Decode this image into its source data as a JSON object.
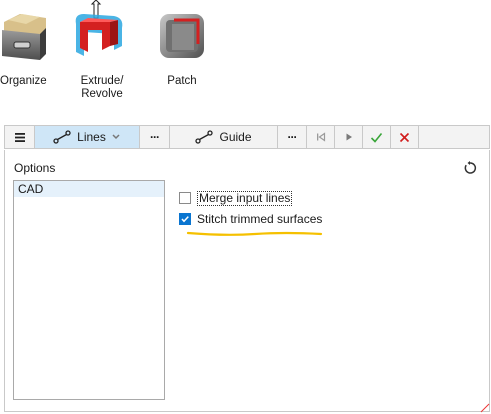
{
  "ribbon": {
    "tools": [
      {
        "label": "Organize",
        "icon": "organize-box-icon"
      },
      {
        "label": "Extrude/",
        "label2": "Revolve",
        "icon": "extrude-revolve-icon"
      },
      {
        "label": "Patch",
        "icon": "patch-icon"
      }
    ]
  },
  "toolbar": {
    "menu_icon": "hamburger-menu-icon",
    "lines_label": "Lines",
    "guide_label": "Guide",
    "more_label": "···",
    "accent": "#cfe6f7",
    "confirm_color": "#3aa63a",
    "cancel_color": "#d11c1c"
  },
  "panel": {
    "title": "Options",
    "list": [
      "CAD"
    ],
    "options": [
      {
        "label": "Merge input lines",
        "checked": false
      },
      {
        "label": "Stitch trimmed surfaces",
        "checked": true
      }
    ],
    "reset_icon": "reset-icon",
    "highlight_color": "#f5c000"
  }
}
